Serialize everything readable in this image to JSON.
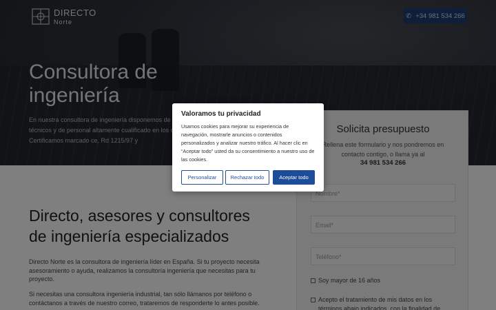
{
  "header": {
    "logo_line1": "DIRECTO",
    "logo_line2": "Norte",
    "phone_label": "+34 981 534 266",
    "phone_icon": "phone-icon"
  },
  "hero": {
    "title": "Consultora de ingeniería",
    "text": "En nuestra consultora de ingeniería disponemos de medios técnicos y de personal altamente cualificado en los campos. Certificamos marcado ce, Rd 1215/97 y"
  },
  "quote_form": {
    "title": "Solicita presupuesto",
    "subtitle": "Rellena este formulario y nos pondremos en contacto contigo, o llama ya al",
    "phone": "34 981 534 266",
    "name_placeholder": "Nombre*",
    "email_placeholder": "Email*",
    "phone_placeholder": "Teléfono*",
    "age_check": "Soy mayor de 16 años",
    "privacy_check": "Acepto el tratamiento de mis datos en los términos abajo indicados, con la finalidad de"
  },
  "main": {
    "title": "Directo, asesores y consultores de ingeniería especializados",
    "p1": "Directo Norte es la consultora de ingeniería líder en España. Si tu proyecto necesita asesoramiento o ayuda, realizamos la consultoría ingeniería que necesitas para tu proyecto.",
    "p2": "Si necesitas una consultora ingeniería industrial, tan sólo llámanos por teléfono o contáctanos a través de nuestro correo, trataremos de responderte lo antes posible."
  },
  "cookie_modal": {
    "title": "Valoramos tu privacidad",
    "body": "Usamos cookies para mejorar su experiencia de navegación, mostrarle anuncios o contenidos personalizados y analizar nuestro tráfico. Al hacer clic en “Aceptar todo” usted da su consentimiento a nuestro uso de las cookies.",
    "customize_label": "Personalizar",
    "reject_label": "Rechazar todo",
    "accept_label": "Aceptar todo"
  },
  "colors": {
    "accent": "#1d4c99",
    "phone_button": "#1f3f73"
  }
}
